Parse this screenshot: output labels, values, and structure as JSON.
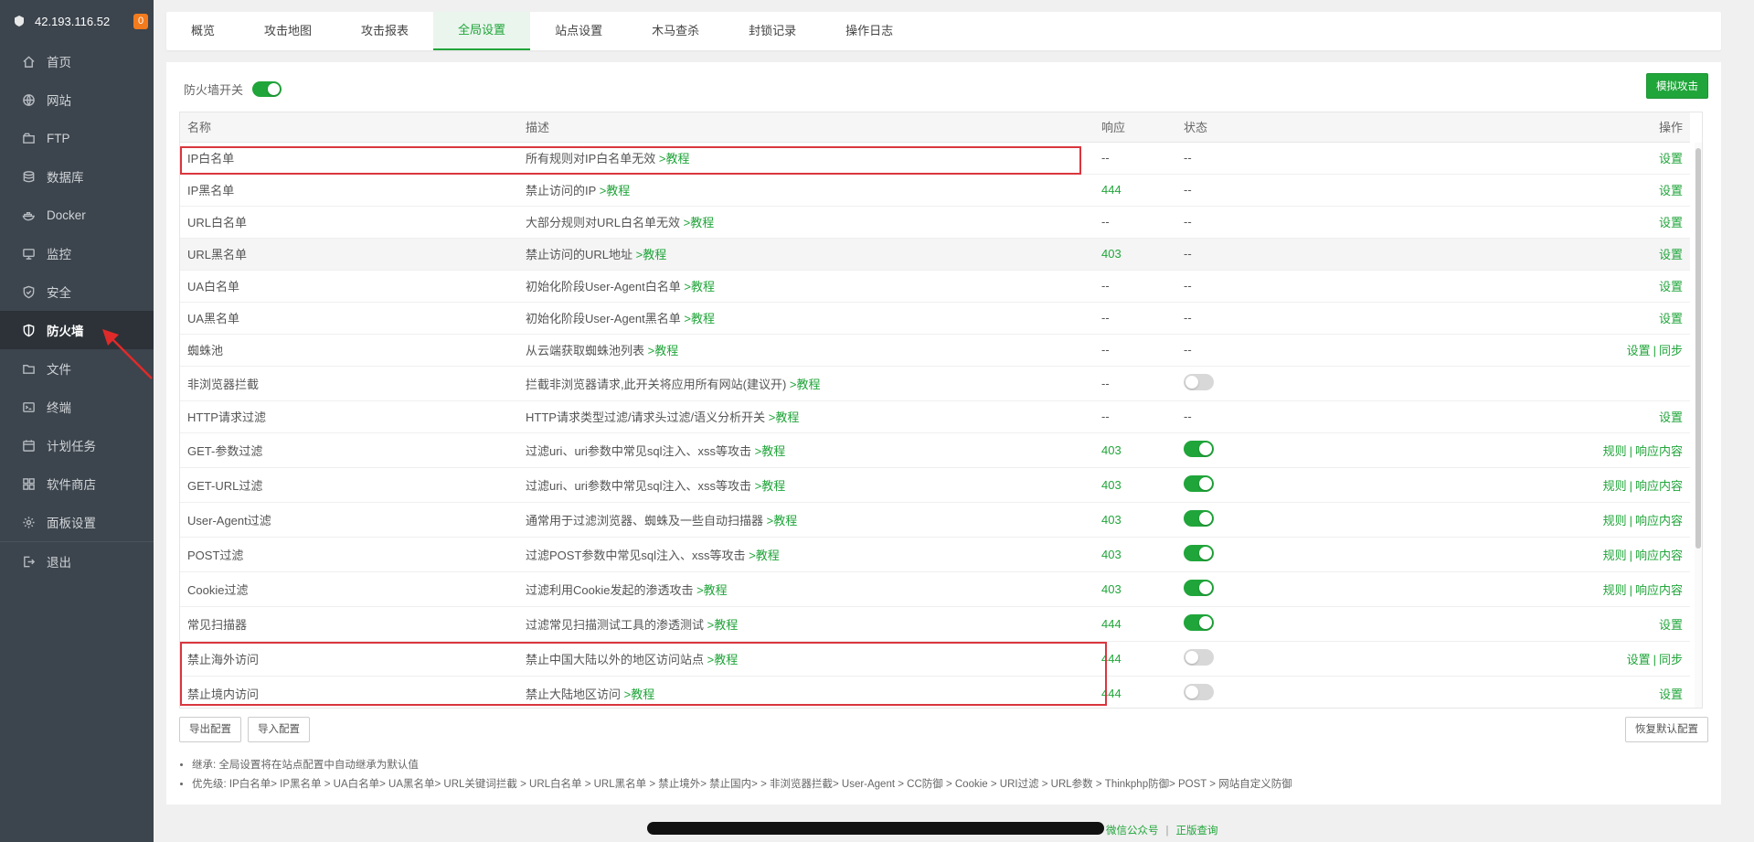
{
  "sidebar": {
    "ip": "42.193.116.52",
    "badge": "0",
    "items": [
      {
        "label": "首页",
        "icon": "home-icon"
      },
      {
        "label": "网站",
        "icon": "globe-icon"
      },
      {
        "label": "FTP",
        "icon": "ftp-icon"
      },
      {
        "label": "数据库",
        "icon": "database-icon"
      },
      {
        "label": "Docker",
        "icon": "docker-icon"
      },
      {
        "label": "监控",
        "icon": "monitor-icon"
      },
      {
        "label": "安全",
        "icon": "shield-icon"
      },
      {
        "label": "防火墙",
        "icon": "firewall-icon"
      },
      {
        "label": "文件",
        "icon": "folder-icon"
      },
      {
        "label": "终端",
        "icon": "terminal-icon"
      },
      {
        "label": "计划任务",
        "icon": "calendar-icon"
      },
      {
        "label": "软件商店",
        "icon": "apps-icon"
      },
      {
        "label": "面板设置",
        "icon": "gear-icon"
      },
      {
        "label": "退出",
        "icon": "logout-icon"
      }
    ]
  },
  "tabs": [
    "概览",
    "攻击地图",
    "攻击报表",
    "全局设置",
    "站点设置",
    "木马查杀",
    "封锁记录",
    "操作日志"
  ],
  "main": {
    "firewall_switch_label": "防火墙开关",
    "simulate_button": "模拟攻击",
    "columns": {
      "name": "名称",
      "desc": "描述",
      "resp": "响应",
      "status": "状态",
      "action": "操作"
    },
    "tutorial_label": ">教程",
    "rows": [
      {
        "name": "IP白名单",
        "desc": "所有规则对IP白名单无效",
        "resp": "--",
        "status": "--",
        "actions": [
          "设置"
        ]
      },
      {
        "name": "IP黑名单",
        "desc": "禁止访问的IP",
        "resp": "444",
        "status": "--",
        "actions": [
          "设置"
        ]
      },
      {
        "name": "URL白名单",
        "desc": "大部分规则对URL白名单无效",
        "resp": "--",
        "status": "--",
        "actions": [
          "设置"
        ]
      },
      {
        "name": "URL黑名单",
        "desc": "禁止访问的URL地址",
        "resp": "403",
        "status": "--",
        "actions": [
          "设置"
        ]
      },
      {
        "name": "UA白名单",
        "desc": "初始化阶段User-Agent白名单",
        "resp": "--",
        "status": "--",
        "actions": [
          "设置"
        ]
      },
      {
        "name": "UA黑名单",
        "desc": "初始化阶段User-Agent黑名单",
        "resp": "--",
        "status": "--",
        "actions": [
          "设置"
        ]
      },
      {
        "name": "蜘蛛池",
        "desc": "从云端获取蜘蛛池列表",
        "resp": "--",
        "status": "--",
        "actions": [
          "设置",
          "同步"
        ]
      },
      {
        "name": "非浏览器拦截",
        "desc": "拦截非浏览器请求,此开关将应用所有网站(建议开)",
        "resp": "--",
        "status": "toggle-off",
        "actions": []
      },
      {
        "name": "HTTP请求过滤",
        "desc": "HTTP请求类型过滤/请求头过滤/语义分析开关",
        "resp": "--",
        "status": "--",
        "actions": [
          "设置"
        ]
      },
      {
        "name": "GET-参数过滤",
        "desc": "过滤uri、uri参数中常见sql注入、xss等攻击",
        "resp": "403",
        "status": "toggle-on",
        "actions": [
          "规则",
          "响应内容"
        ]
      },
      {
        "name": "GET-URL过滤",
        "desc": "过滤uri、uri参数中常见sql注入、xss等攻击",
        "resp": "403",
        "status": "toggle-on",
        "actions": [
          "规则",
          "响应内容"
        ]
      },
      {
        "name": "User-Agent过滤",
        "desc": "通常用于过滤浏览器、蜘蛛及一些自动扫描器",
        "resp": "403",
        "status": "toggle-on",
        "actions": [
          "规则",
          "响应内容"
        ]
      },
      {
        "name": "POST过滤",
        "desc": "过滤POST参数中常见sql注入、xss等攻击",
        "resp": "403",
        "status": "toggle-on",
        "actions": [
          "规则",
          "响应内容"
        ]
      },
      {
        "name": "Cookie过滤",
        "desc": "过滤利用Cookie发起的渗透攻击",
        "resp": "403",
        "status": "toggle-on",
        "actions": [
          "规则",
          "响应内容"
        ]
      },
      {
        "name": "常见扫描器",
        "desc": "过滤常见扫描测试工具的渗透测试",
        "resp": "444",
        "status": "toggle-on",
        "actions": [
          "设置"
        ]
      },
      {
        "name": "禁止海外访问",
        "desc": "禁止中国大陆以外的地区访问站点",
        "resp": "444",
        "status": "toggle-off",
        "actions": [
          "设置",
          "同步"
        ]
      },
      {
        "name": "禁止境内访问",
        "desc": "禁止大陆地区访问",
        "resp": "444",
        "status": "toggle-off",
        "actions": [
          "设置"
        ]
      }
    ],
    "export_button": "导出配置",
    "import_button": "导入配置",
    "restore_button": "恢复默认配置",
    "notes": [
      "继承: 全局设置将在站点配置中自动继承为默认值",
      "优先级: IP白名单> IP黑名单 > UA白名单> UA黑名单> URL关键词拦截 > URL白名单 > URL黑名单 > 禁止境外> 禁止国内> > 非浏览器拦截> User-Agent > CC防御 > Cookie > URI过滤 > URL参数 > Thinkphp防御> POST > 网站自定义防御"
    ]
  },
  "footer": {
    "wechat": "微信公众号",
    "genuine": "正版查询"
  },
  "colors": {
    "accent": "#20a53a",
    "sidebar": "#3c444d",
    "highlight": "#d9363e"
  }
}
